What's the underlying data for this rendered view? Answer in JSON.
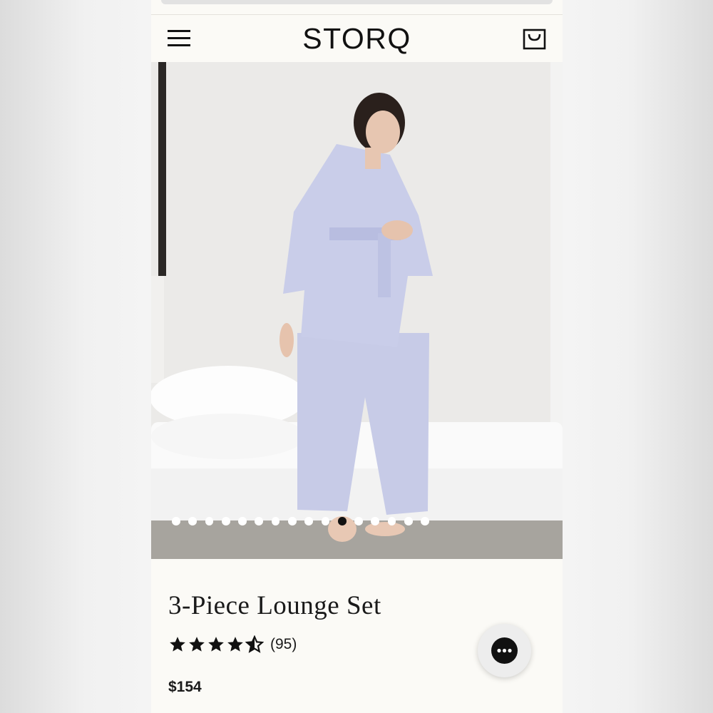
{
  "header": {
    "brand": "STORQ",
    "menu_icon": "hamburger-menu-icon",
    "cart_icon": "shopping-bag-icon"
  },
  "gallery": {
    "image_alt": "Model wearing lavender 3-piece lounge set",
    "dot_count": 16,
    "active_dot_index": 10
  },
  "product": {
    "title": "3-Piece Lounge Set",
    "rating": 4.5,
    "review_count": "(95)",
    "price": "$154"
  },
  "chat": {
    "icon": "chat-bubble-icon"
  },
  "colors": {
    "lavender": "#c9cde9",
    "text": "#1a1a1a",
    "background": "#fbfaf6"
  }
}
